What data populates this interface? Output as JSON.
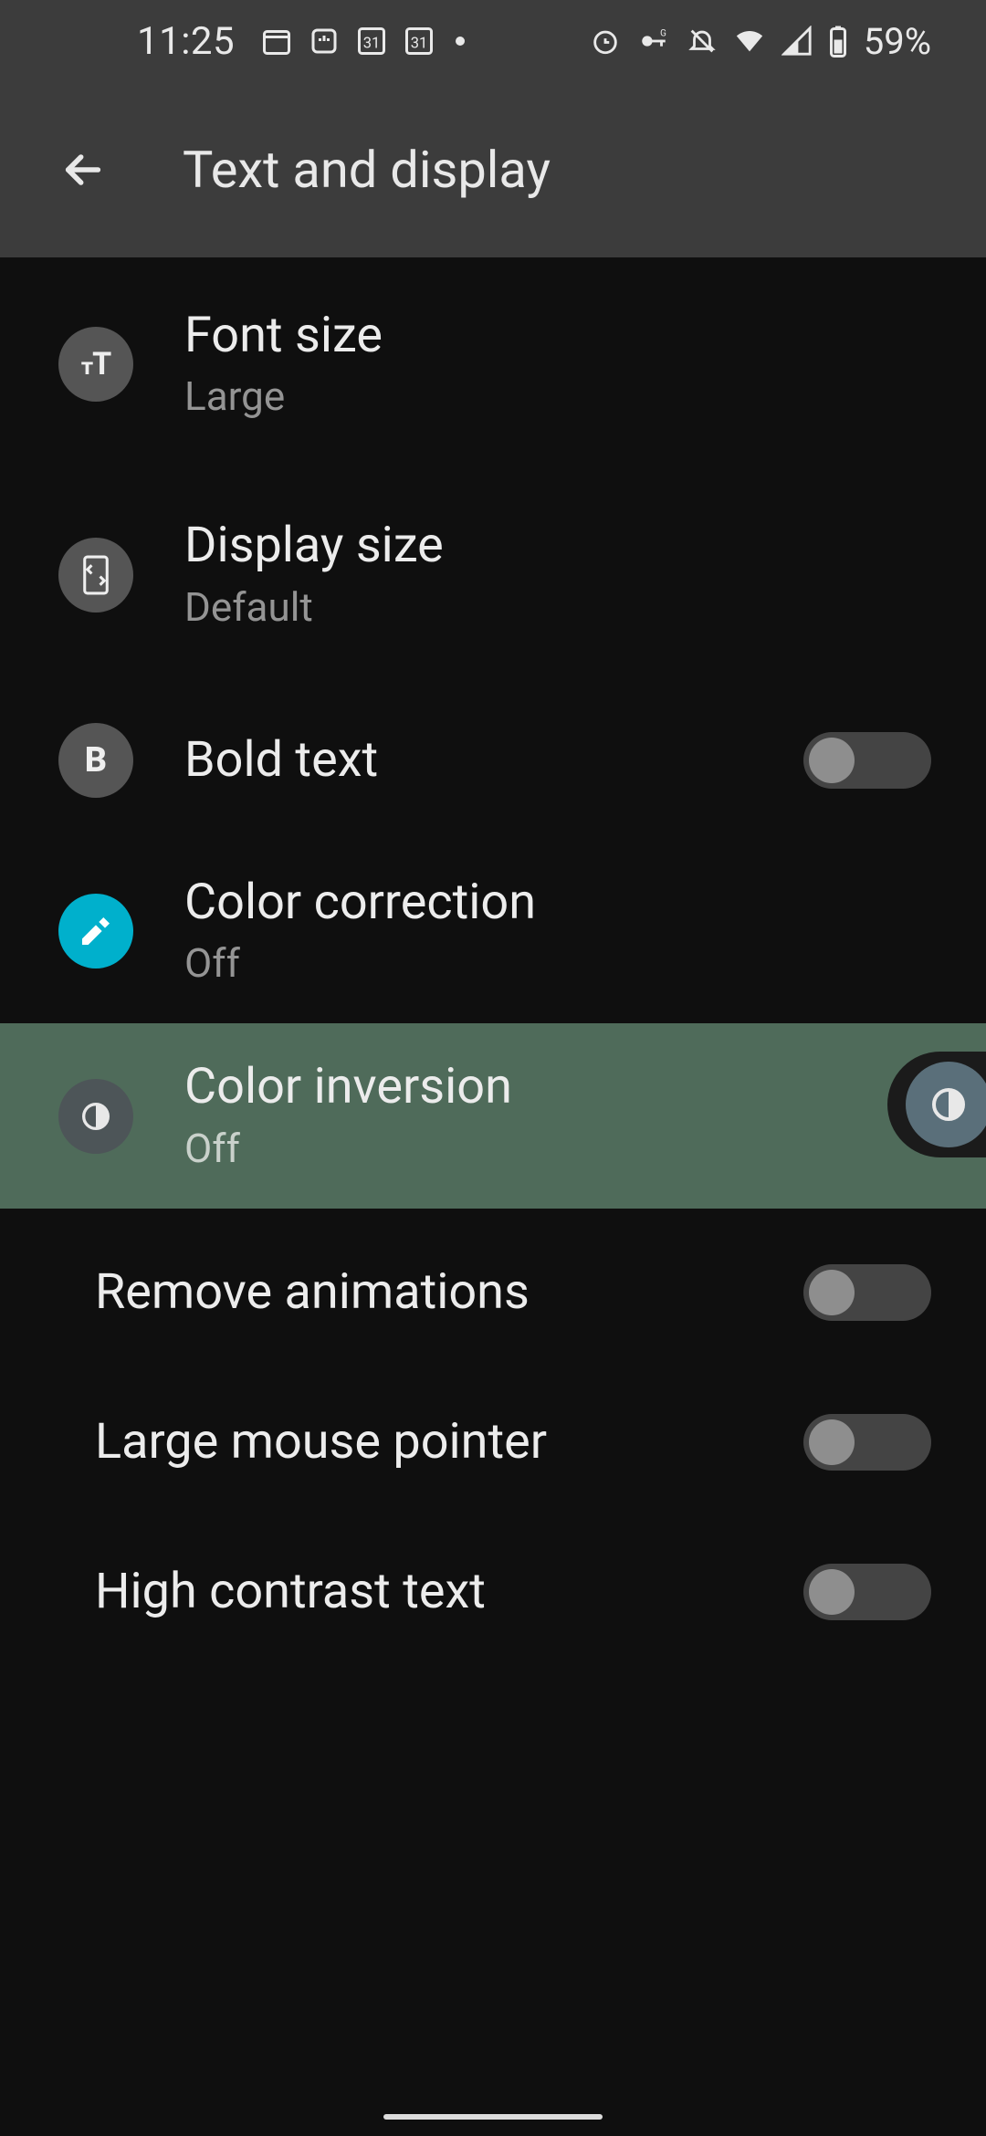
{
  "status": {
    "time": "11:25",
    "battery": "59%"
  },
  "header": {
    "title": "Text and display"
  },
  "items": {
    "font_size": {
      "title": "Font size",
      "subtitle": "Large"
    },
    "display_size": {
      "title": "Display size",
      "subtitle": "Default"
    },
    "bold_text": {
      "title": "Bold text"
    },
    "color_corr": {
      "title": "Color correction",
      "subtitle": "Off"
    },
    "color_inv": {
      "title": "Color inversion",
      "subtitle": "Off"
    },
    "remove_anim": {
      "title": "Remove animations"
    },
    "large_ptr": {
      "title": "Large mouse pointer"
    },
    "high_contrast": {
      "title": "High contrast text"
    }
  }
}
